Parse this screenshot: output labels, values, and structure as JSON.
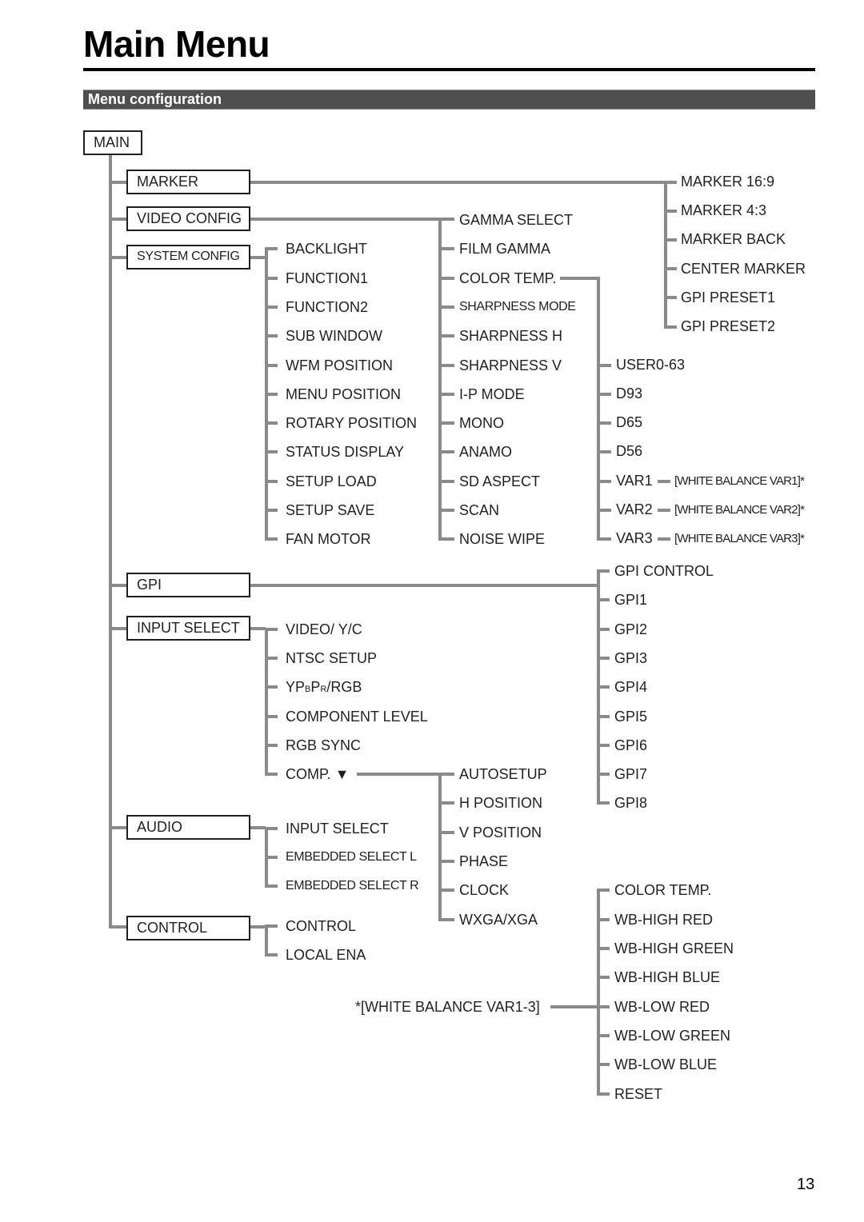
{
  "page": {
    "title": "Main Menu",
    "section": "Menu configuration",
    "page_number": "13"
  },
  "menu": {
    "root": "MAIN",
    "level1": {
      "marker": "MARKER",
      "video_config": "VIDEO CONFIG",
      "system_config": "SYSTEM CONFIG",
      "gpi": "GPI",
      "input_select": "INPUT SELECT",
      "audio": "AUDIO",
      "control": "CONTROL"
    },
    "marker_items": [
      "MARKER 16:9",
      "MARKER 4:3",
      "MARKER BACK",
      "CENTER MARKER",
      "GPI PRESET1",
      "GPI PRESET2"
    ],
    "video_config_items": [
      "GAMMA SELECT",
      "FILM GAMMA",
      "COLOR TEMP.",
      "SHARPNESS MODE",
      "SHARPNESS H",
      "SHARPNESS V",
      "I-P MODE",
      "MONO",
      "ANAMO",
      "SD ASPECT",
      "SCAN",
      "NOISE WIPE"
    ],
    "system_config_items": [
      "BACKLIGHT",
      "FUNCTION1",
      "FUNCTION2",
      "SUB WINDOW",
      "WFM POSITION",
      "MENU POSITION",
      "ROTARY POSITION",
      "STATUS DISPLAY",
      "SETUP LOAD",
      "SETUP SAVE",
      "FAN MOTOR"
    ],
    "color_temp_items": [
      "USER0-63",
      "D93",
      "D65",
      "D56",
      "VAR1",
      "VAR2",
      "VAR3"
    ],
    "white_balance_refs": [
      "[WHITE BALANCE VAR1]*",
      "[WHITE BALANCE VAR2]*",
      "[WHITE BALANCE VAR3]*"
    ],
    "gpi_items": [
      "GPI CONTROL",
      "GPI1",
      "GPI2",
      "GPI3",
      "GPI4",
      "GPI5",
      "GPI6",
      "GPI7",
      "GPI8"
    ],
    "input_select_items": [
      "VIDEO/ Y/C",
      "NTSC SETUP",
      "YPBPR/RGB",
      "COMPONENT LEVEL",
      "RGB SYNC",
      "COMP. ▼"
    ],
    "ypbpr": {
      "y": "YP",
      "b": "B",
      "p": "P",
      "r": "R",
      "rest": "/RGB"
    },
    "comp_items": [
      "AUTOSETUP",
      "H POSITION",
      "V POSITION",
      "PHASE",
      "CLOCK",
      "WXGA/XGA"
    ],
    "audio_items": [
      "INPUT SELECT",
      "EMBEDDED SELECT L",
      "EMBEDDED SELECT R"
    ],
    "control_items": [
      "CONTROL",
      "LOCAL ENA"
    ],
    "white_balance_label": "*[WHITE BALANCE VAR1-3]",
    "white_balance_items": [
      "COLOR TEMP.",
      "WB-HIGH RED",
      "WB-HIGH GREEN",
      "WB-HIGH BLUE",
      "WB-LOW RED",
      "WB-LOW GREEN",
      "WB-LOW BLUE",
      "RESET"
    ]
  }
}
